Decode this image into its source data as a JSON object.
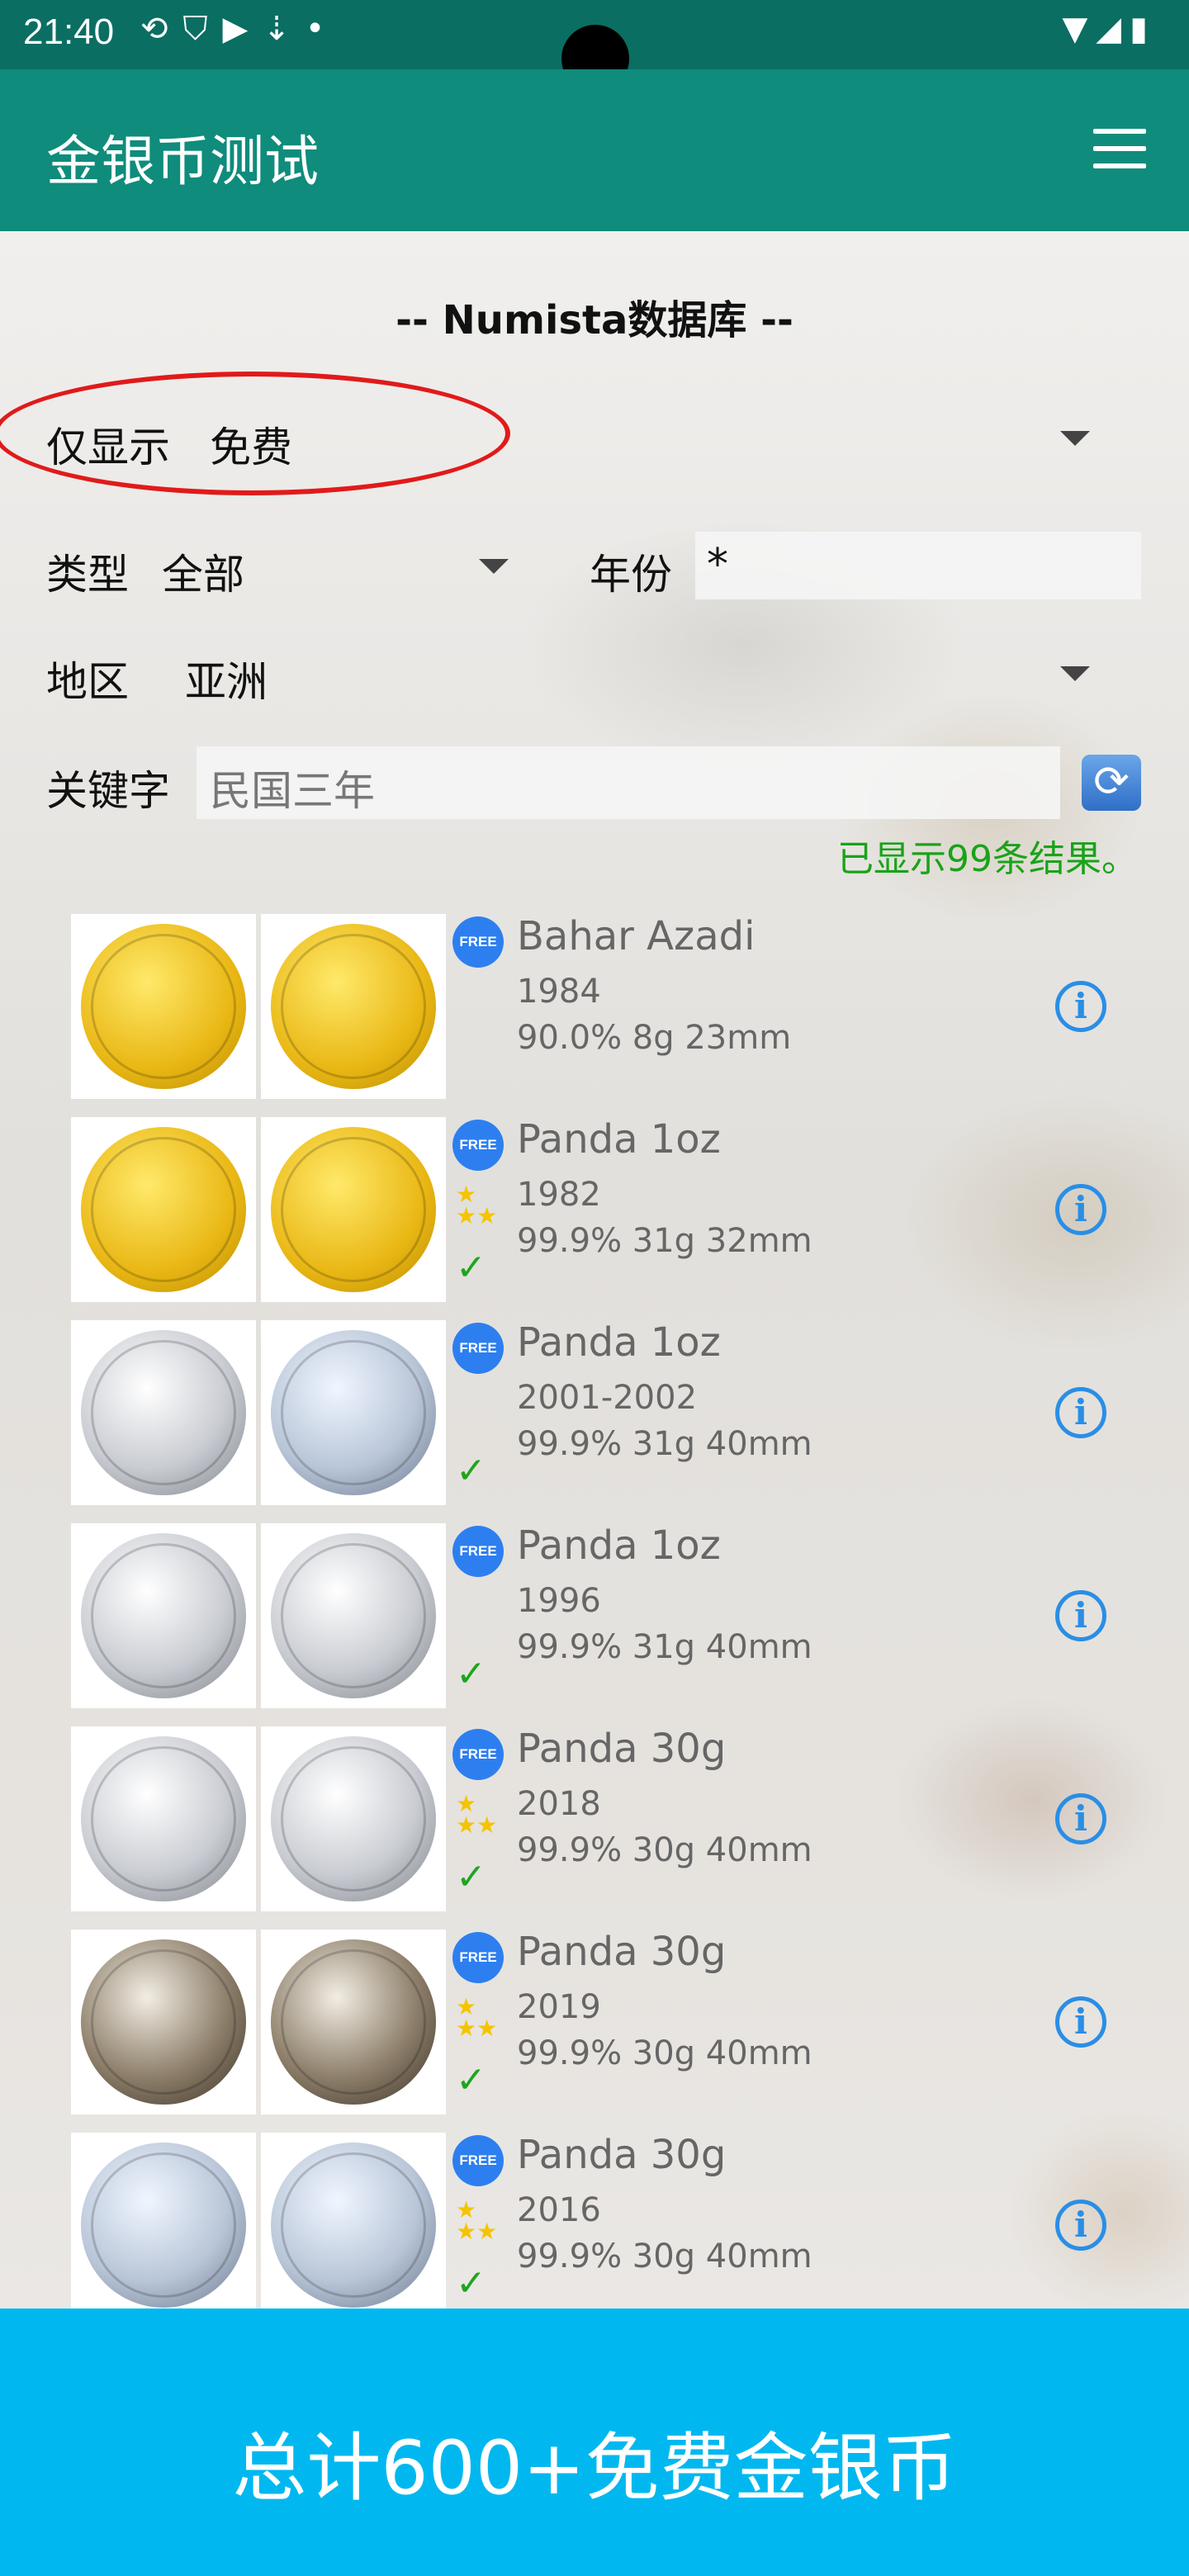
{
  "status_bar": {
    "time": "21:40",
    "icons": [
      "sync-icon",
      "shield-icon",
      "play-icon",
      "download-icon",
      "dot-icon"
    ],
    "right_icons": [
      "wifi-icon",
      "signal-icon",
      "battery-icon"
    ]
  },
  "app_bar": {
    "title": "金银币测试",
    "menu_icon": "hamburger-menu-icon"
  },
  "db_title": "-- Numista数据库 --",
  "filters": {
    "show_only_label": "仅显示",
    "show_only_value": "免费",
    "type_label": "类型",
    "type_value": "全部",
    "year_label": "年份",
    "year_value": "*",
    "region_label": "地区",
    "region_value": "亚洲",
    "keyword_label": "关键字",
    "keyword_placeholder": "民国三年"
  },
  "result_count": "已显示99条结果。",
  "items": [
    {
      "title": "Bahar Azadi",
      "year": "1984",
      "specs": "90.0% 8g 23mm",
      "badge": "FREE",
      "stars": 0,
      "checked": false,
      "obverse": "gold",
      "reverse": "gold"
    },
    {
      "title": "Panda 1oz",
      "year": "1982",
      "specs": "99.9% 31g 32mm",
      "badge": "FREE",
      "stars": 2,
      "checked": true,
      "obverse": "gold",
      "reverse": "gold"
    },
    {
      "title": "Panda 1oz",
      "year": "2001-2002",
      "specs": "99.9% 31g 40mm",
      "badge": "FREE",
      "stars": 0,
      "checked": true,
      "obverse": "silver",
      "reverse": "blue"
    },
    {
      "title": "Panda 1oz",
      "year": "1996",
      "specs": "99.9% 31g 40mm",
      "badge": "FREE",
      "stars": 0,
      "checked": true,
      "obverse": "silver",
      "reverse": "silver"
    },
    {
      "title": "Panda 30g",
      "year": "2018",
      "specs": "99.9% 30g 40mm",
      "badge": "FREE",
      "stars": 2,
      "checked": true,
      "obverse": "silver",
      "reverse": "silver"
    },
    {
      "title": "Panda 30g",
      "year": "2019",
      "specs": "99.9% 30g 40mm",
      "badge": "FREE",
      "stars": 2,
      "checked": true,
      "obverse": "dark",
      "reverse": "dark"
    },
    {
      "title": "Panda 30g",
      "year": "2016",
      "specs": "99.9% 30g 40mm",
      "badge": "FREE",
      "stars": 2,
      "checked": true,
      "obverse": "blue",
      "reverse": "blue"
    }
  ],
  "banner_text": "总计600+免费金银币"
}
